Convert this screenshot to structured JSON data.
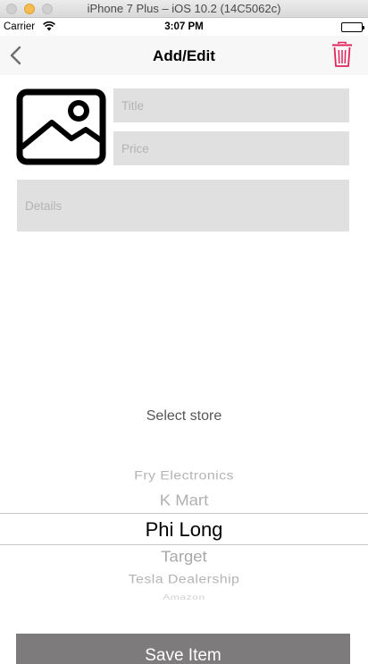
{
  "window": {
    "title": "iPhone 7 Plus – iOS 10.2 (14C5062c)"
  },
  "status_bar": {
    "carrier": "Carrier",
    "time": "3:07 PM"
  },
  "nav_bar": {
    "title": "Add/Edit",
    "back_icon": "chevron-left-icon",
    "trash_icon": "trash-icon"
  },
  "form": {
    "photo_icon": "image-placeholder-icon",
    "title_field": {
      "placeholder": "Title",
      "value": ""
    },
    "price_field": {
      "placeholder": "Price",
      "value": ""
    },
    "details_field": {
      "placeholder": "Details",
      "value": ""
    }
  },
  "store_picker": {
    "label": "Select store",
    "options": [
      "Fry Electronics",
      "K Mart",
      "Phi Long",
      "Target",
      "Tesla Dealership",
      "Amazon"
    ],
    "selected": "Phi Long"
  },
  "save_button": {
    "label": "Save Item"
  },
  "colors": {
    "nav_background": "#f7f7f7",
    "field_background": "#e0e0e0",
    "trash_accent": "#e0245e",
    "save_button": "#7d7b7c"
  }
}
